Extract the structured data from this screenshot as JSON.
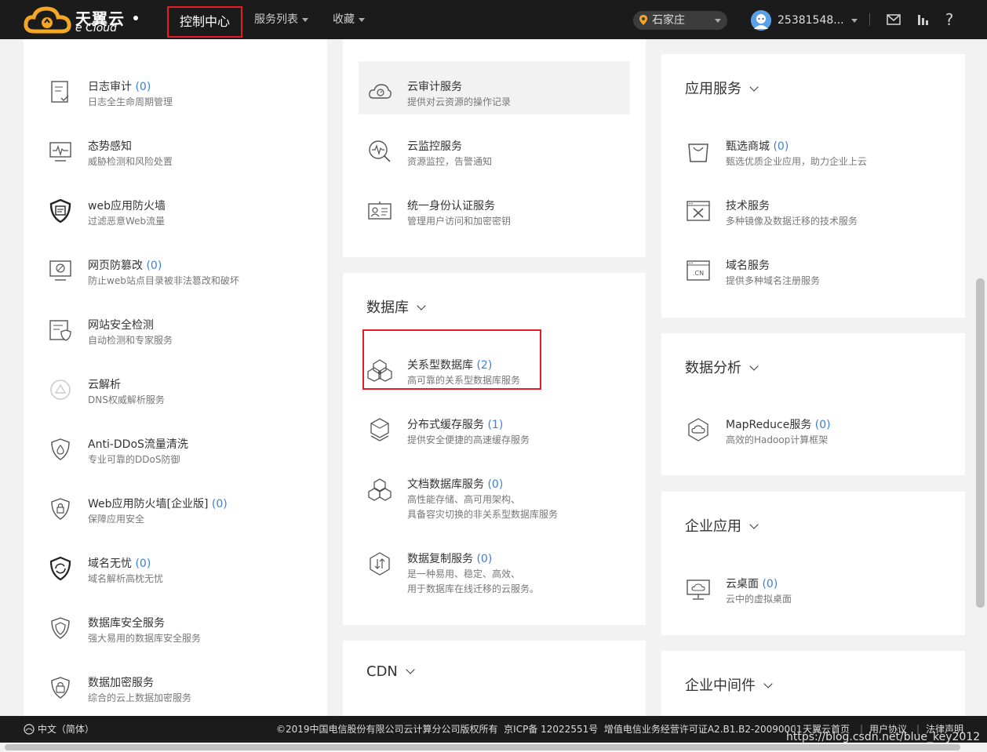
{
  "header": {
    "brand_cn": "天翼云",
    "brand_en": "e Cloud",
    "nav": {
      "console": "控制中心",
      "services": "服务列表",
      "favorites": "收藏"
    },
    "region": "石家庄",
    "user": "25381548...",
    "icons": [
      "mail-icon",
      "chart-icon",
      "help-icon"
    ]
  },
  "left": {
    "items": [
      {
        "title": "日志审计",
        "count": "(0)",
        "desc": "日志全生命周期管理"
      },
      {
        "title": "态势感知",
        "count": "",
        "desc": "威胁检测和风险处置"
      },
      {
        "title": "web应用防火墙",
        "count": "",
        "desc": "过滤恶意Web流量"
      },
      {
        "title": "网页防篡改",
        "count": "(0)",
        "desc": "防止web站点目录被非法篡改和破坏"
      },
      {
        "title": "网站安全检测",
        "count": "",
        "desc": "自动检测和专家服务"
      },
      {
        "title": "云解析",
        "count": "",
        "desc": "DNS权威解析服务"
      },
      {
        "title": "Anti-DDoS流量清洗",
        "count": "",
        "desc": "专业可靠的DDoS防御"
      },
      {
        "title": "Web应用防火墙[企业版]",
        "count": "(0)",
        "desc": "保障应用安全"
      },
      {
        "title": "域名无忧",
        "count": "(0)",
        "desc": "域名解析高枕无忧"
      },
      {
        "title": "数据库安全服务",
        "count": "",
        "desc": "强大易用的数据库安全服务"
      },
      {
        "title": "数据加密服务",
        "count": "",
        "desc": "综合的云上数据加密服务"
      }
    ]
  },
  "middle": {
    "mgmt_items": [
      {
        "title": "云审计服务",
        "count": "",
        "desc": "提供对云资源的操作记录"
      },
      {
        "title": "云监控服务",
        "count": "",
        "desc": "资源监控，告警通知"
      },
      {
        "title": "统一身份认证服务",
        "count": "",
        "desc": "管理用户访问和加密密钥"
      }
    ],
    "db_title": "数据库",
    "db_items": [
      {
        "title": "关系型数据库",
        "count": "(2)",
        "desc": "高可靠的关系型数据库服务",
        "desc2": ""
      },
      {
        "title": "分布式缓存服务",
        "count": "(1)",
        "desc": "提供安全便捷的高速缓存服务",
        "desc2": ""
      },
      {
        "title": "文档数据库服务",
        "count": "(0)",
        "desc": "高性能存储、高可用架构、",
        "desc2": "具备容灾切换的非关系型数据库服务"
      },
      {
        "title": "数据复制服务",
        "count": "(0)",
        "desc": "是一种易用、稳定、高效、",
        "desc2": "用于数据库在线迁移的云服务。"
      }
    ],
    "cdn_title": "CDN"
  },
  "right": {
    "app_title": "应用服务",
    "app_items": [
      {
        "title": "甄选商城",
        "count": "(0)",
        "desc": "甄选优质企业应用，助力企业上云"
      },
      {
        "title": "技术服务",
        "count": "",
        "desc": "多种镜像及数据迁移的技术服务"
      },
      {
        "title": "域名服务",
        "count": "",
        "desc": "提供多种域名注册服务"
      }
    ],
    "domain_badge": ".CN",
    "analytics_title": "数据分析",
    "analytics_items": [
      {
        "title": "MapReduce服务",
        "count": "(0)",
        "desc": "高效的Hadoop计算框架"
      }
    ],
    "enterprise_title": "企业应用",
    "enterprise_items": [
      {
        "title": "云桌面",
        "count": "(0)",
        "desc": "云中的虚拟桌面"
      }
    ],
    "middleware_title": "企业中间件"
  },
  "footer": {
    "language": "中文（简体）",
    "copyright": "©2019中国电信股份有限公司云计算分公司版权所有  京ICP备 12022551号  增值电信业务经营许可证A2.B1.B2-20090001",
    "links": [
      "天翼云首页",
      "用户协议",
      "法律声明"
    ],
    "watermark": "https://blog.csdn.net/blue_key2012"
  },
  "colors": {
    "topbar": "#1b1b1b",
    "highlight_border": "#e51c23",
    "accent": "#f5a623",
    "count": "#3c7fd6"
  }
}
